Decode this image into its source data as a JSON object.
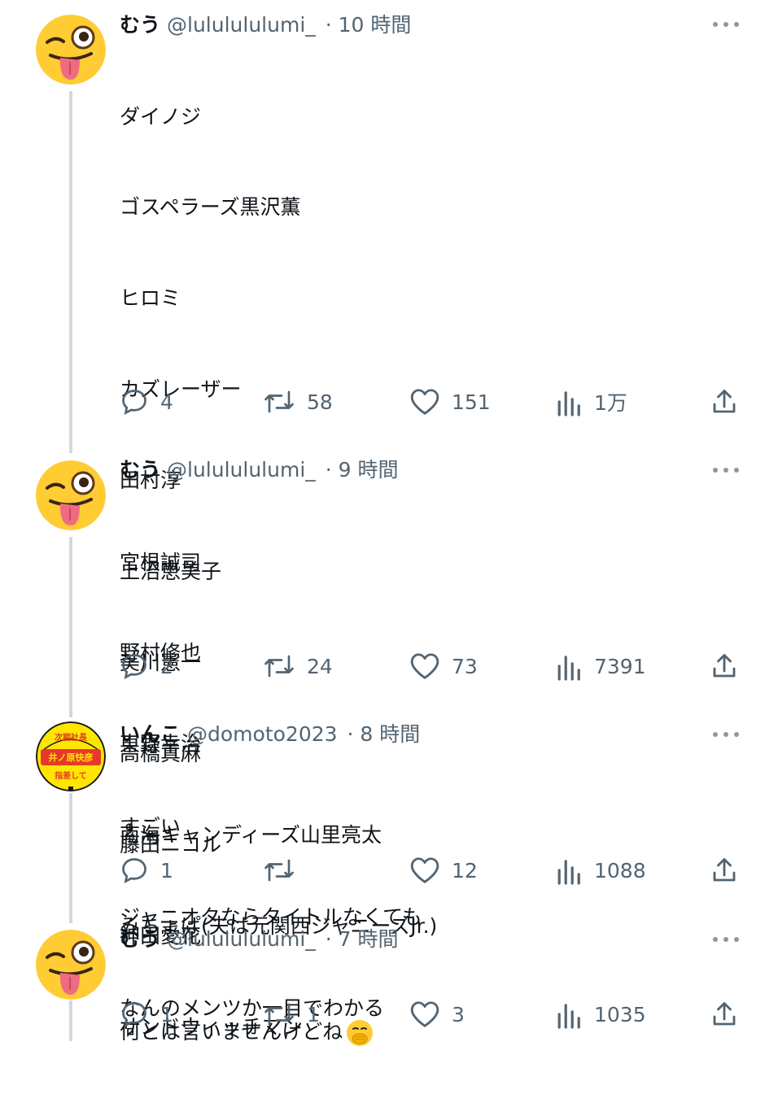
{
  "tweets": [
    {
      "name": "むう",
      "handle": "@lululululumi_",
      "time": "· 10 時間",
      "avatar": "wink-tongue-emoji",
      "lines": [
        "ダイノジ",
        "ゴスペラーズ黒沢薫",
        "ヒロミ",
        "カズレーザー",
        "田村淳",
        "上沼恵美子",
        "美川憲一",
        "高橋真麻",
        "藤田ニコル",
        "神田愛花",
        "サンドウィッチマン"
      ],
      "replies": "4",
      "retweets": "58",
      "likes": "151",
      "views": "1万"
    },
    {
      "name": "むう",
      "handle": "@lululululumi_",
      "time": "· 9 時間",
      "avatar": "wink-tongue-emoji",
      "lines": [
        "宮根誠司",
        "野村修也",
        "東野幸治",
        "南海キャンディーズ山里亮太",
        "みちょぱ(夫は元関西ジャニーズJr.)"
      ],
      "replies": "2",
      "retweets": "24",
      "likes": "73",
      "views": "7391"
    },
    {
      "name": "いんこ",
      "handle": "@domoto2023",
      "time": "· 8 時間",
      "avatar": "fan-uchiwa-avatar",
      "avatar_text": {
        "top": "次期社長",
        "middle": "井ノ原快彦",
        "bottom": "指差して"
      },
      "lines": [
        "すごい",
        "ジャニオタならタイトルなくても",
        "なんのメンツか一目でわかる"
      ],
      "replies": "1",
      "retweets": "",
      "likes": "12",
      "views": "1088"
    },
    {
      "name": "むう",
      "handle": "@lululululumi_",
      "time": "· 7 時間",
      "avatar": "wink-tongue-emoji",
      "lines": [
        "何とは言いませんけどね"
      ],
      "trailing_emoji": "face-with-hand-over-mouth-emoji",
      "replies": "1",
      "retweets": "1",
      "likes": "3",
      "views": "1035"
    }
  ],
  "colors": {
    "text": "#0f1419",
    "secondary": "#536471",
    "thread": "#cfd9de",
    "emoji": "#ffcc33"
  }
}
